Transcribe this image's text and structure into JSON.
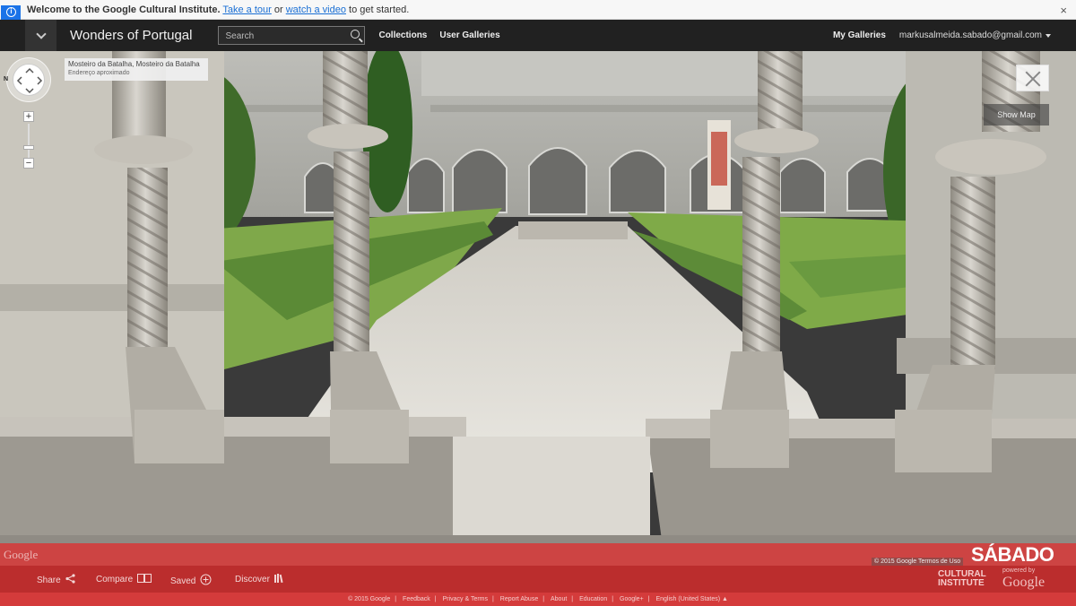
{
  "welcome": {
    "lead": "Welcome to the Google Cultural Institute.",
    "tour_link": "Take a tour",
    "or_text": "or",
    "video_link": "watch a video",
    "tail": "to get started.",
    "close_glyph": "×"
  },
  "nav": {
    "title": "Wonders of Portugal",
    "search_placeholder": "Search",
    "collections": "Collections",
    "user_galleries": "User Galleries",
    "my_galleries": "My Galleries",
    "account": "markusalmeida.sabado@gmail.com"
  },
  "viewer": {
    "place_title": "Mosteiro da Batalha, Mosteiro da Batalha",
    "place_subtitle": "Endereço aproximado",
    "compass_label": "N",
    "zoom_in": "+",
    "zoom_out": "−",
    "show_map": "Show Map",
    "google_watermark": "Google",
    "terms_chip": "© 2015 Google   Termos de Uso",
    "brand": "SÁBADO"
  },
  "toolbar": {
    "share": "Share",
    "compare": "Compare",
    "saved": "Saved",
    "discover": "Discover",
    "ci_logo": "CULTURAL INSTITUTE",
    "powered_by": "powered by",
    "powered_google": "Google"
  },
  "footer": {
    "links": [
      "© 2015 Google",
      "Feedback",
      "Privacy & Terms",
      "Report Abuse",
      "About",
      "Education",
      "Google+",
      "English (United States) ▲"
    ]
  },
  "icons": {
    "info": "info-ribbon-icon",
    "chevron": "chevron-down-icon",
    "search": "search-icon",
    "share": "share-icon",
    "compare": "compare-icon",
    "saved": "plus-circle-icon",
    "discover": "books-icon"
  },
  "colors": {
    "nav_bg": "#212121",
    "accent_red": "#d43b3b",
    "link_blue": "#1a6fd4"
  }
}
